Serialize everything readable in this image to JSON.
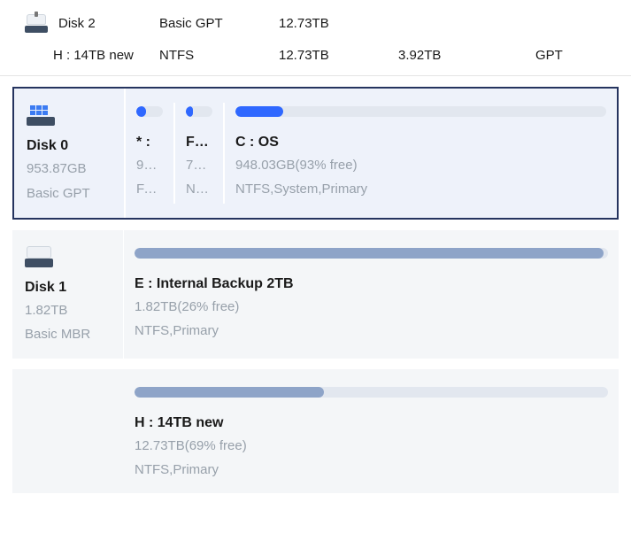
{
  "header": {
    "disk_label": "Disk 2",
    "scheme": "Basic GPT",
    "size": "12.73TB",
    "vol_label": "H : 14TB new",
    "fs": "NTFS",
    "vol_size": "12.73TB",
    "free": "3.92TB",
    "scheme2": "GPT"
  },
  "disk0": {
    "name": "Disk 0",
    "size": "953.87GB",
    "scheme": "Basic GPT",
    "parts": [
      {
        "title": "* :",
        "line1": "99....",
        "line2": "FAT...",
        "fill": 36
      },
      {
        "title": "F : ...",
        "line1": "750...",
        "line2": "NT...",
        "fill": 28
      },
      {
        "title": "C : OS",
        "line1": "948.03GB(93% free)",
        "line2": "NTFS,System,Primary",
        "fill": 13
      }
    ]
  },
  "disk1": {
    "name": "Disk 1",
    "size": "1.82TB",
    "scheme": "Basic MBR",
    "part": {
      "title": "E : Internal Backup 2TB",
      "line1": "1.82TB(26% free)",
      "line2": "NTFS,Primary",
      "fill": 99
    }
  },
  "disk2_card": {
    "part": {
      "title": "H : 14TB new",
      "line1": "12.73TB(69% free)",
      "line2": "NTFS,Primary",
      "fill": 40
    }
  }
}
